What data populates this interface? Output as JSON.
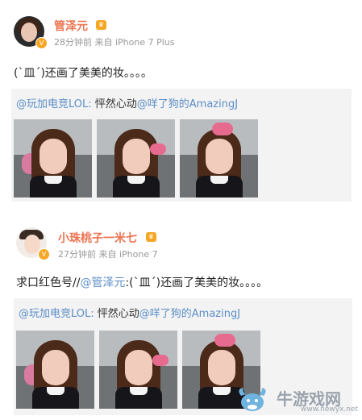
{
  "post1": {
    "username": "管泽元",
    "meta": "28分钟前 来自 iPhone 7 Plus",
    "text": "(`皿´)还画了美美的妆。。。。",
    "repost": {
      "author": "@玩加电竞LOL:",
      "text": " 怦然心动",
      "mention": "@咩了狗的AmazingJ"
    }
  },
  "post2": {
    "username": "小珠桃子一米七",
    "meta": "27分钟前 来自 iPhone 7",
    "text_prefix": "求口红色号//",
    "mention": "@管泽元",
    "text_suffix": ":(`皿´)还画了美美的妆。。。。",
    "repost": {
      "author": "@玩加电竞LOL:",
      "text": " 怦然心动",
      "mention": "@咩了狗的AmazingJ"
    }
  },
  "watermark": {
    "name": "牛游戏网",
    "url": "www.newyx.net"
  }
}
